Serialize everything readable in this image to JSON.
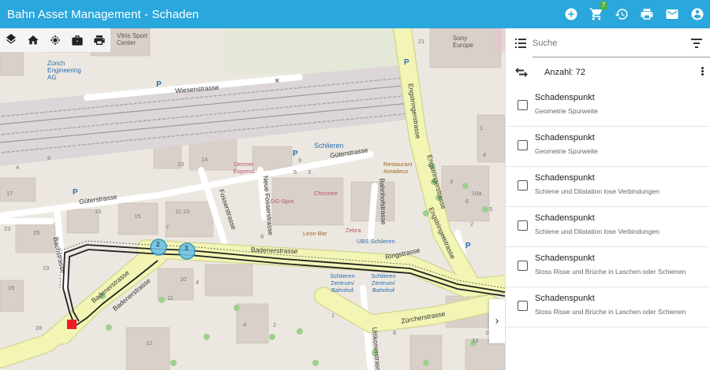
{
  "app": {
    "title": "Bahn Asset Management - Schaden",
    "cart_count": "7",
    "top_icons": [
      "add-circle-icon",
      "cart-icon",
      "history-icon",
      "print-icon",
      "mail-icon",
      "account-icon"
    ]
  },
  "map": {
    "toolbar_icons": [
      "layers-icon",
      "home-icon",
      "locate-icon",
      "briefcase-icon",
      "print-icon"
    ],
    "streets": {
      "wiesenstrasse": "Wiesenstrasse",
      "gueterstrasse_top": "Güterstrasse",
      "gueterstrasse_left": "Güterstrasse",
      "fosserstrasse": "Fosserstrasse",
      "neue_fosserstrasse": "Neue Fosserstrasse",
      "bahnhofstrasse": "Bahnhofstrasse",
      "engstringerstrasse_1": "Engstringerstrasse",
      "engstringerstrasse_2": "Engstringerstrasse",
      "engstringerstrasse_3": "Engstringerstrasse",
      "badenerstrasse_top": "Badenerstrasse",
      "badenerstrasse_1": "Badenerstrasse",
      "badenerstrasse_2": "Badenerstrasse",
      "ringstrasse": "Ringstrasse",
      "zuercherstrasse": "Zürcherstrasse",
      "bachstrasse": "Bachstrasse",
      "uitikonerstrasse": "Uitikonerstrasse"
    },
    "places": {
      "zuerich_engineering": "Zürich Engineering AG",
      "vitris": "Vitris Sport Center",
      "sony": "Sony Europe",
      "schlieren": "Schlieren",
      "denner": "Denner Express",
      "restaurant": "Restaurant Amadeus",
      "dg_spot": "DG-Spot",
      "chicoree": "Chicorée",
      "leon_bar": "Leon Bar",
      "zebra": "Zebra",
      "ubs": "UBS Schlieren",
      "schlieren_zentrum_1": "Schlieren Zentrum/ Bahnhof",
      "schlieren_zentrum_2": "Schlieren Zentrum/ Bahnhof"
    },
    "house_numbers": {
      "n1": "10",
      "n2": "14",
      "n3": "9",
      "n4": "5",
      "n5": "3",
      "n6": "15",
      "n7": "11;13",
      "n8": "7",
      "n9": "9",
      "n10": "4",
      "n11": "6",
      "n12": "17",
      "n13": "13",
      "n14": "23",
      "n15": "25",
      "n16": "19",
      "n17": "19",
      "n18": "10",
      "n19": "11",
      "n20": "4",
      "n21": "12",
      "n22": "1",
      "n23": "21",
      "n24": "4",
      "n25": "3",
      "n26": "6",
      "n27": "10a",
      "n28": "5",
      "n29": "2",
      "n30": "4",
      "n31": "13",
      "n32": "16",
      "n33": "4",
      "n34": "2",
      "n35": "28",
      "n36": "8",
      "n37": "1"
    },
    "cluster_markers": [
      "2",
      "3"
    ]
  },
  "panel": {
    "search_placeholder": "Suche",
    "count_label": "Anzahl: 72",
    "items": [
      {
        "title": "Schadenspunkt",
        "subtitle": "Geometrie Spurweite"
      },
      {
        "title": "Schadenspunkt",
        "subtitle": "Geometrie Spurweite"
      },
      {
        "title": "Schadenspunkt",
        "subtitle": "Schiene und Dilatation lose Verbindungen"
      },
      {
        "title": "Schadenspunkt",
        "subtitle": "Schiene und Dilatation lose Verbindungen"
      },
      {
        "title": "Schadenspunkt",
        "subtitle": "Stoss Risse und Brüche in Laschen oder Schienen"
      },
      {
        "title": "Schadenspunkt",
        "subtitle": "Stoss Risse und Brüche in Laschen oder Schienen"
      }
    ]
  },
  "colors": {
    "topbar": "#2aa7dc",
    "main_road": "#f3f5b5",
    "rail": "#a8a8a8",
    "building": "#d9d0c9",
    "marker_red": "#ee1c25"
  }
}
